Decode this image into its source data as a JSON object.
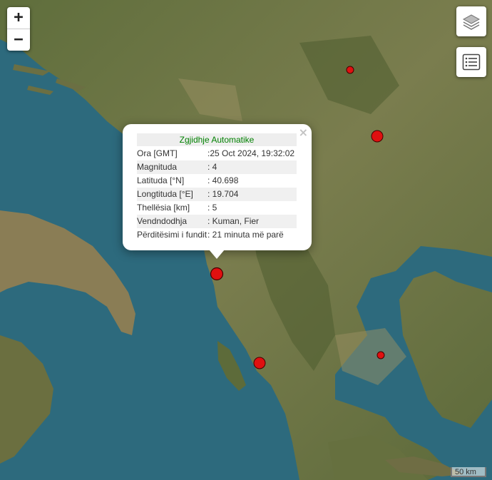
{
  "zoom": {
    "in_label": "+",
    "out_label": "−"
  },
  "popup": {
    "title": "Zgjidhje Automatike",
    "close_label": "×",
    "rows": [
      {
        "label": "Ora [GMT]",
        "value": ":25 Oct 2024, 19:32:02"
      },
      {
        "label": "Magnituda",
        "value": ": 4"
      },
      {
        "label": "Latituda [°N]",
        "value": ": 40.698"
      },
      {
        "label": "Longtituda [°E]",
        "value": ": 19.704"
      },
      {
        "label": "Thellësia [km]",
        "value": ": 5"
      },
      {
        "label": "Vendndodhja",
        "value": ": Kuman, Fier"
      },
      {
        "label": "Përditësimi i fundit",
        "value": ": 21 minuta më parë"
      }
    ]
  },
  "scale": {
    "label": "50 km"
  },
  "controls": {
    "layers_icon": "layers-icon",
    "list_icon": "list-icon"
  },
  "colors": {
    "sea": "#2f6c80",
    "land": "#6d7a46",
    "marker": "#e01010"
  }
}
